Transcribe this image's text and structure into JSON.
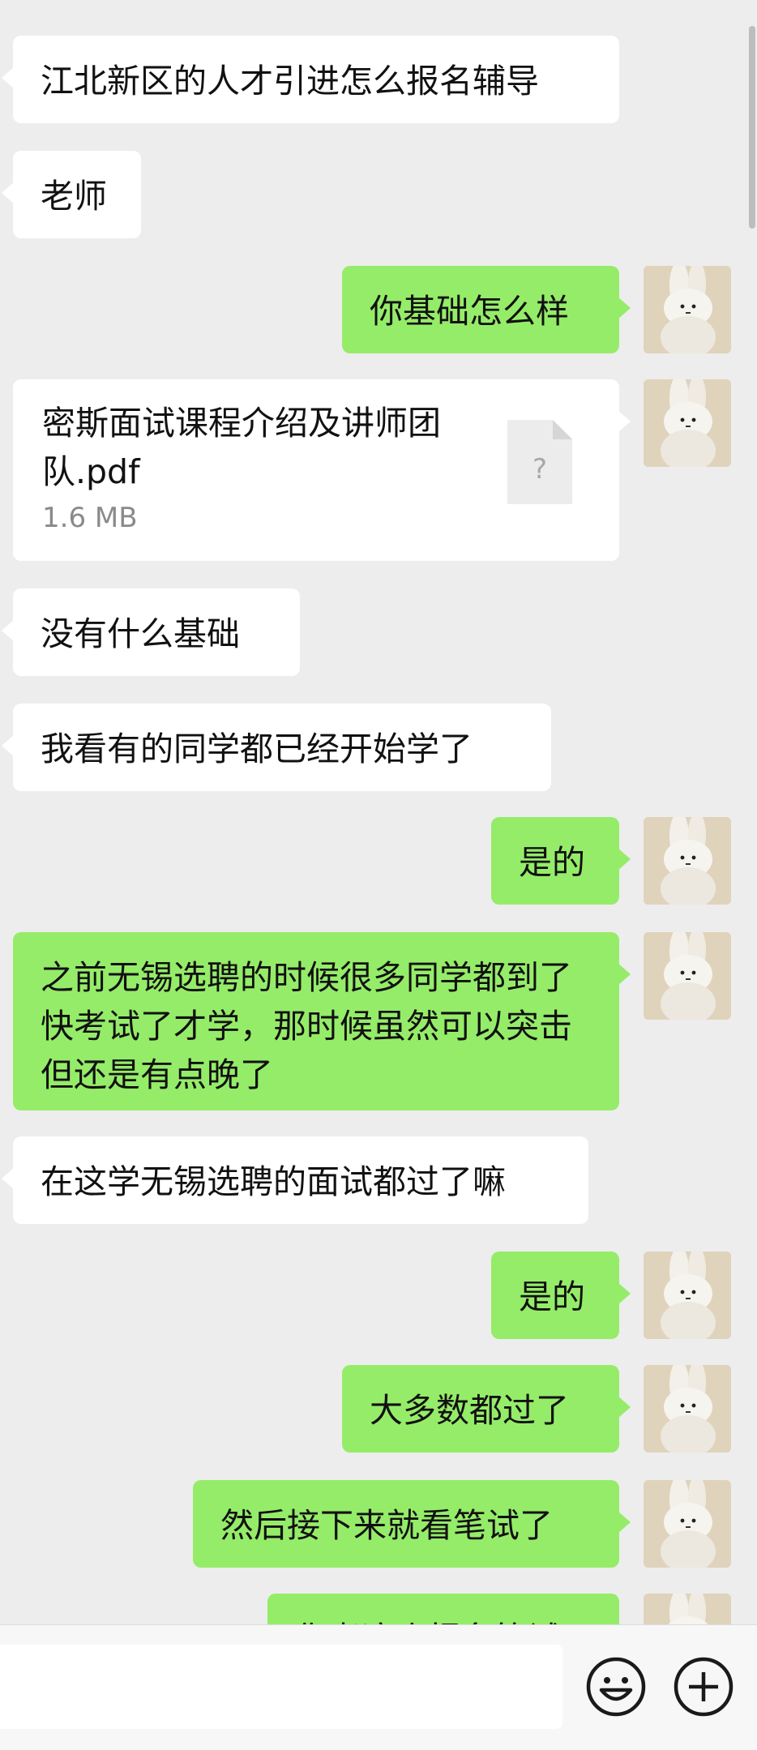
{
  "messages": [
    {
      "side": "in",
      "text": "江北新区的人才引进怎么报名辅导"
    },
    {
      "side": "in",
      "text": "老师"
    },
    {
      "side": "out",
      "text": "你基础怎么样"
    },
    {
      "side": "out",
      "type": "file",
      "file_name": "密斯面试课程介绍及讲师团队.pdf",
      "file_size": "1.6 MB",
      "file_icon_glyph": "?"
    },
    {
      "side": "in",
      "text": "没有什么基础"
    },
    {
      "side": "in",
      "text": "我看有的同学都已经开始学了"
    },
    {
      "side": "out",
      "text": "是的"
    },
    {
      "side": "out",
      "text": "之前无锡选聘的时候很多同学都到了快考试了才学，那时候虽然可以突击但还是有点晚了"
    },
    {
      "side": "in",
      "text": "在这学无锡选聘的面试都过了嘛"
    },
    {
      "side": "out",
      "text": "是的"
    },
    {
      "side": "out",
      "text": "大多数都过了"
    },
    {
      "side": "out",
      "text": "然后接下来就看笔试了"
    },
    {
      "side": "out",
      "text": "你考这个报名笔试"
    }
  ],
  "input": {
    "value": "",
    "placeholder": ""
  },
  "icons": {
    "emoji": "emoji-face-icon",
    "plus": "plus-circle-icon",
    "avatar": "bunny-plush-avatar"
  },
  "colors": {
    "background": "#ededed",
    "incoming": "#ffffff",
    "outgoing": "#95ec69",
    "bar": "#f7f7f7"
  }
}
